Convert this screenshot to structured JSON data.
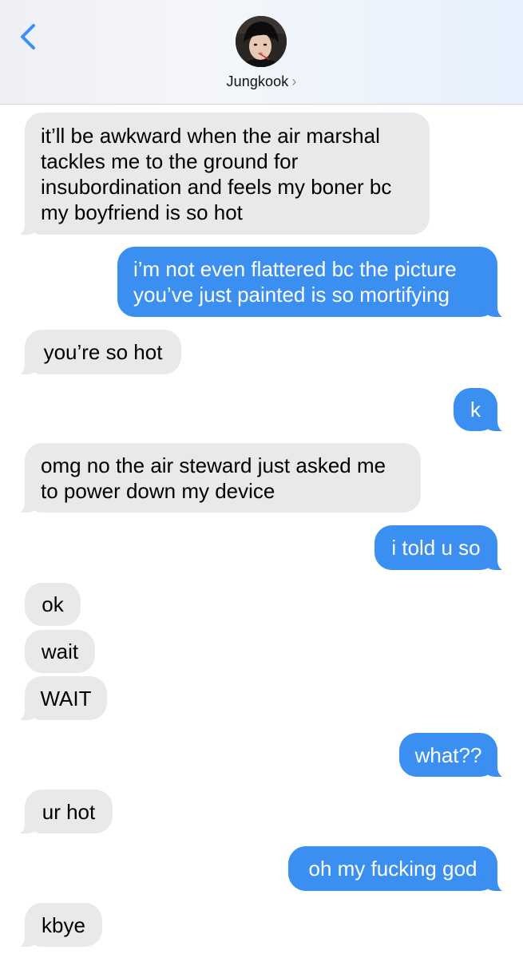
{
  "header": {
    "contact_name": "Jungkook",
    "chevron": "›",
    "back_icon": "chevron-left-icon",
    "accent_color": "#3b8ff0"
  },
  "messages": [
    {
      "sender": "them",
      "lines": [
        "it’ll be awkward when the air marshal",
        "tackles me to the ground for",
        "insubordination and feels my boner bc",
        "my boyfriend is so hot"
      ]
    },
    {
      "sender": "me",
      "lines": [
        "i’m not even flattered bc the picture",
        "you’ve just painted is so mortifying"
      ]
    },
    {
      "sender": "them",
      "lines": [
        "you’re so hot"
      ]
    },
    {
      "sender": "me",
      "lines": [
        "k"
      ]
    },
    {
      "sender": "them",
      "lines": [
        "omg no the air steward just asked me",
        "to power down my device"
      ]
    },
    {
      "sender": "me",
      "lines": [
        "i told u so"
      ]
    },
    {
      "sender": "them",
      "lines": [
        "ok"
      ]
    },
    {
      "sender": "them",
      "lines": [
        "wait"
      ]
    },
    {
      "sender": "them",
      "lines": [
        "WAIT"
      ]
    },
    {
      "sender": "me",
      "lines": [
        "what??"
      ]
    },
    {
      "sender": "them",
      "lines": [
        "ur hot"
      ]
    },
    {
      "sender": "me",
      "lines": [
        "oh my fucking god"
      ]
    },
    {
      "sender": "them",
      "lines": [
        "kbye"
      ]
    }
  ]
}
